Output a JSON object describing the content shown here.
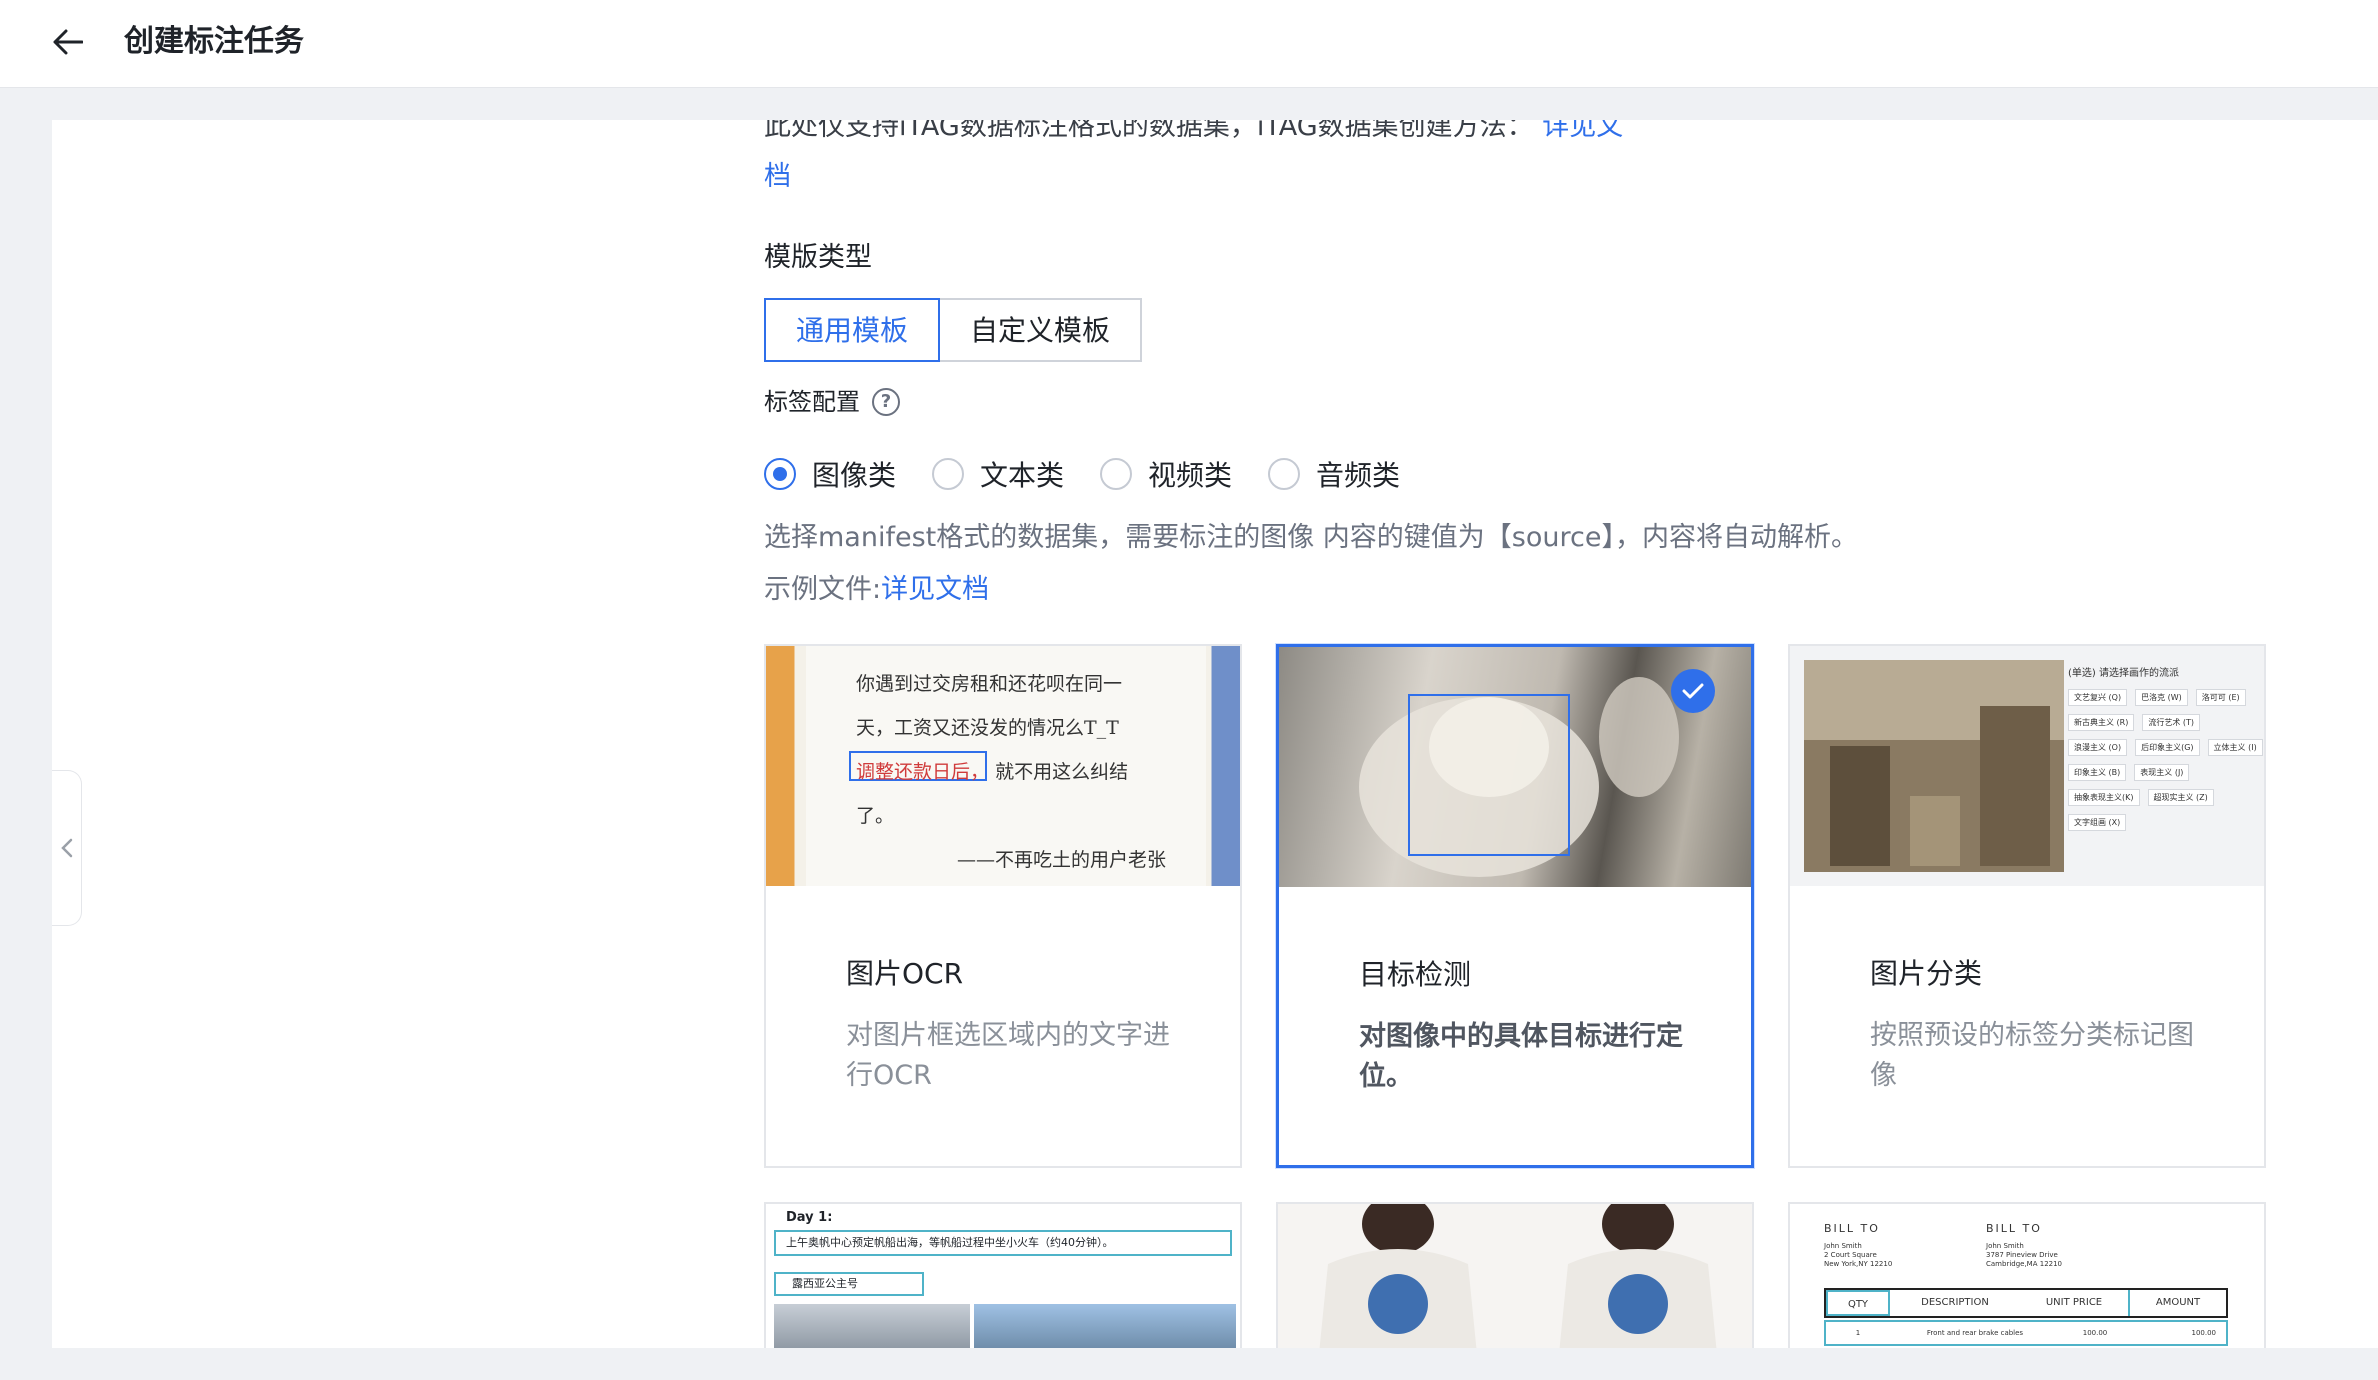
{
  "header": {
    "title": "创建标注任务",
    "back_icon": "arrow-left-icon"
  },
  "dataset_note": {
    "text": "此处仅支持iTAG数据标注格式的数据集，iTAG数据集创建方法：",
    "link": "详见文档"
  },
  "template": {
    "label": "模版类型",
    "options": [
      "通用模板",
      "自定义模板"
    ],
    "selected": "通用模板"
  },
  "label_config": {
    "label": "标签配置",
    "help_icon": "question-circle-icon"
  },
  "media_types": {
    "options": [
      "图像类",
      "文本类",
      "视频类",
      "音频类"
    ],
    "selected": "图像类"
  },
  "description": {
    "line1": "选择manifest格式的数据集，需要标注的图像 内容的键值为【source】，内容将自动解析。",
    "example_prefix": "示例文件:",
    "example_link": "详见文档"
  },
  "cards": [
    {
      "title": "图片OCR",
      "desc": "对图片框选区域内的文字进行OCR",
      "thumb_lines": [
        "你遇到过交房租和还花呗在同一",
        "天，工资又还没发的情况么T_T",
        "调整还款日后，",
        "就不用这么纠结",
        "了。",
        "——不再吃土的用户老张"
      ]
    },
    {
      "title": "目标检测",
      "desc": "对图像中的具体目标进行定位。",
      "selected": true,
      "check_icon": "checkmark-icon"
    },
    {
      "title": "图片分类",
      "desc": "按照预设的标签分类标记图像",
      "thumb_heading": "(单选) 请选择画作的流派",
      "thumb_options": [
        "文艺复兴 (Q)",
        "巴洛克 (W)",
        "洛可可 (E)",
        "新古典主义 (R)",
        "流行艺术 (T)",
        "浪漫主义 (O)",
        "后印象主义(G)",
        "立体主义 (I)",
        "印象主义 (B)",
        "表现主义 (J)",
        "抽象表现主义(K)",
        "超现实主义 (Z)",
        "文字组画 (X)"
      ]
    }
  ],
  "lower_cards": [
    {
      "thumb_heading": "Day 1:",
      "thumb_line1": "上午奥帆中心预定帆船出海，等帆船过程中坐小火车（约40分钟）。",
      "thumb_line2": "露西亚公主号"
    },
    {
      "thumb_alt": "tshirt-photo"
    },
    {
      "bill_to_left": "BILL TO",
      "bill_to_right": "BILL TO",
      "left_addr": [
        "John Smith",
        "2 Court Square",
        "New York,NY 12210"
      ],
      "right_addr": [
        "John Smith",
        "3787 Pineview Drive",
        "Cambridge,MA 12210"
      ],
      "cols": [
        "QTY",
        "DESCRIPTION",
        "UNIT PRICE",
        "AMOUNT"
      ],
      "row": [
        "1",
        "Front and rear brake cables",
        "100.00",
        "100.00"
      ]
    }
  ],
  "side_toggle_icon": "chevron-left-icon",
  "colors": {
    "accent": "#2f6fea",
    "border": "#e4e6ea",
    "muted_text": "#8a9099"
  }
}
